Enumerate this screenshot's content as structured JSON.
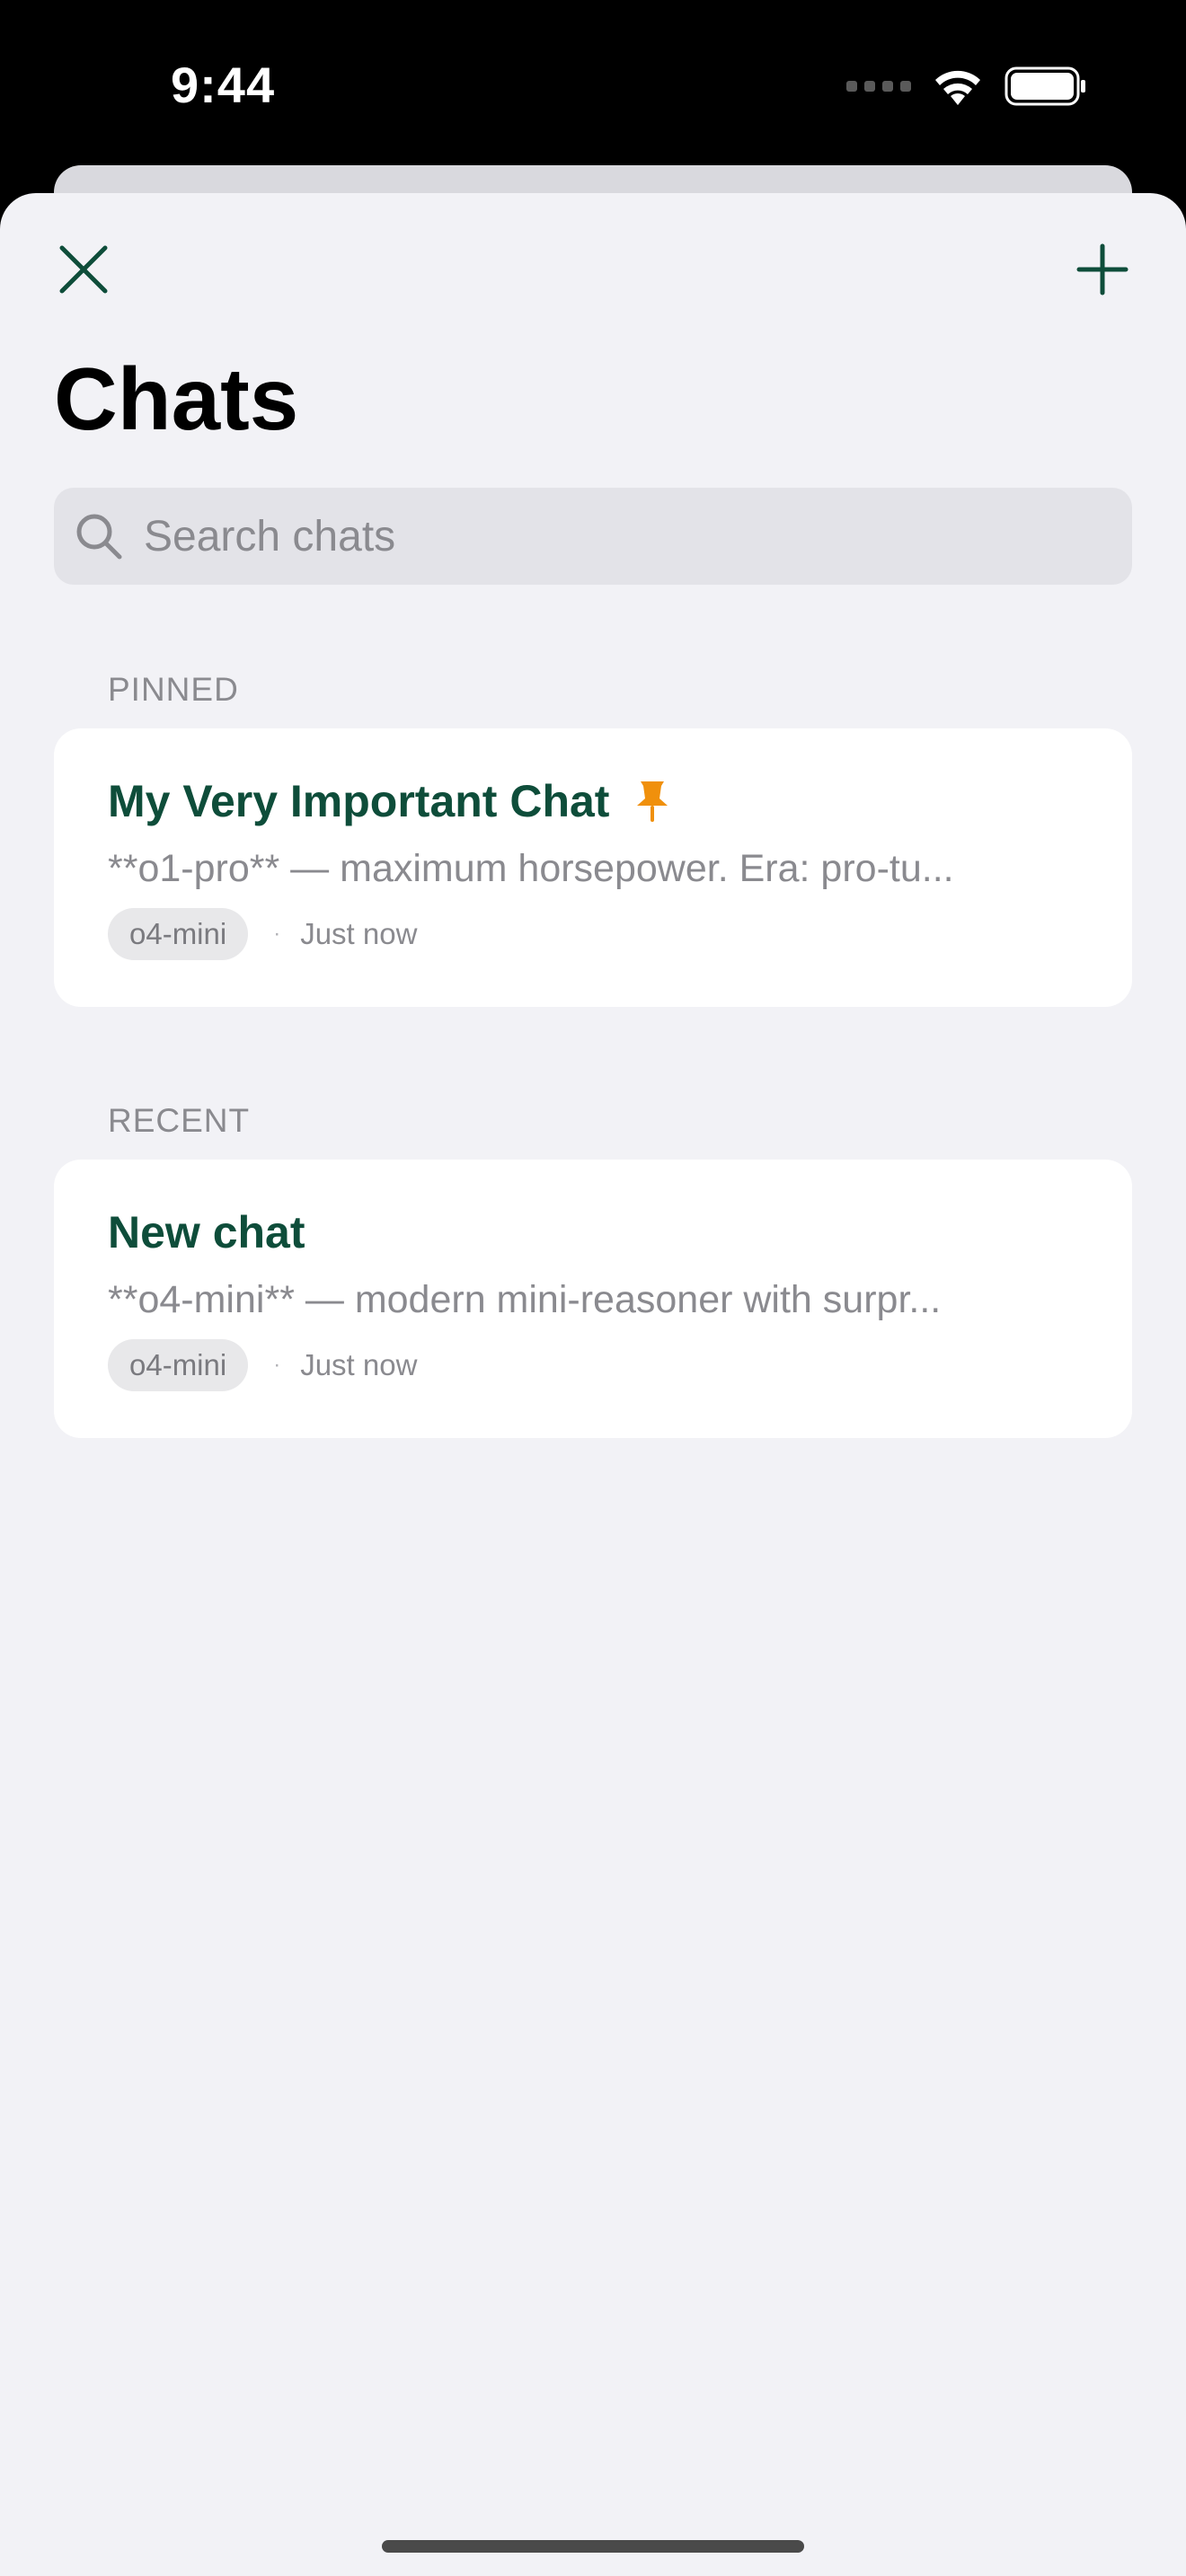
{
  "status_bar": {
    "time": "9:44",
    "icons": [
      "cellular-signal-icon",
      "wifi-icon",
      "battery-icon"
    ]
  },
  "header": {
    "close_icon": "close-icon",
    "new_chat_icon": "plus-icon",
    "title": "Chats"
  },
  "search": {
    "placeholder": "Search chats",
    "value": ""
  },
  "sections": {
    "pinned": {
      "label": "PINNED",
      "items": [
        {
          "title": "My Very Important Chat",
          "pinned_icon": "pin-icon",
          "preview": "**o1-pro** — maximum horsepower. Era: pro-tu...",
          "model": "o4-mini",
          "separator": "·",
          "time": "Just now"
        }
      ]
    },
    "recent": {
      "label": "RECENT",
      "items": [
        {
          "title": "New chat",
          "preview": "**o4-mini** — modern mini-reasoner with surpr...",
          "model": "o4-mini",
          "separator": "·",
          "time": "Just now"
        }
      ]
    }
  },
  "colors": {
    "accent": "#0e4d3a",
    "pin": "#f0900c",
    "sheet_background": "#f2f2f6",
    "secondary_text": "#8a8a8f"
  }
}
